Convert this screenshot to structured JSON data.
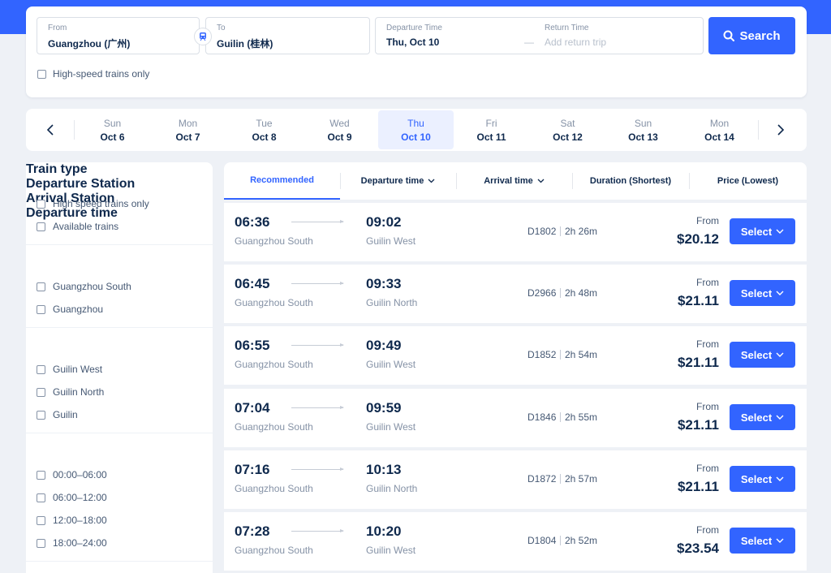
{
  "search": {
    "from_label": "From",
    "from_value": "Guangzhou (广州)",
    "to_label": "To",
    "to_value": "Guilin (桂林)",
    "departure_label": "Departure Time",
    "departure_value": "Thu, Oct 10",
    "return_label": "Return Time",
    "return_dash": "—",
    "return_placeholder": "Add return trip",
    "search_button": "Search",
    "high_speed_label": "High-speed trains only"
  },
  "dates": [
    {
      "day": "Sun",
      "date": "Oct 6"
    },
    {
      "day": "Mon",
      "date": "Oct 7"
    },
    {
      "day": "Tue",
      "date": "Oct 8"
    },
    {
      "day": "Wed",
      "date": "Oct 9"
    },
    {
      "day": "Thu",
      "date": "Oct 10"
    },
    {
      "day": "Fri",
      "date": "Oct 11"
    },
    {
      "day": "Sat",
      "date": "Oct 12"
    },
    {
      "day": "Sun",
      "date": "Oct 13"
    },
    {
      "day": "Mon",
      "date": "Oct 14"
    }
  ],
  "filters": {
    "train_type": {
      "title": "Train type",
      "options": [
        "High speed trains only",
        "Available trains"
      ]
    },
    "departure_station": {
      "title": "Departure Station",
      "options": [
        "Guangzhou South",
        "Guangzhou"
      ]
    },
    "arrival_station": {
      "title": "Arrival Station",
      "options": [
        "Guilin West",
        "Guilin North",
        "Guilin"
      ]
    },
    "departure_time": {
      "title": "Departure time",
      "options": [
        "00:00–06:00",
        "06:00–12:00",
        "12:00–18:00",
        "18:00–24:00"
      ]
    }
  },
  "sort": {
    "tabs": [
      "Recommended",
      "Departure time",
      "Arrival time",
      "Duration (Shortest)",
      "Price (Lowest)"
    ]
  },
  "results": [
    {
      "dep_time": "06:36",
      "dep_station": "Guangzhou South",
      "arr_time": "09:02",
      "arr_station": "Guilin West",
      "train": "D1802",
      "duration": "2h 26m",
      "from_label": "From",
      "price": "$20.12",
      "select": "Select"
    },
    {
      "dep_time": "06:45",
      "dep_station": "Guangzhou South",
      "arr_time": "09:33",
      "arr_station": "Guilin North",
      "train": "D2966",
      "duration": "2h 48m",
      "from_label": "From",
      "price": "$21.11",
      "select": "Select"
    },
    {
      "dep_time": "06:55",
      "dep_station": "Guangzhou South",
      "arr_time": "09:49",
      "arr_station": "Guilin West",
      "train": "D1852",
      "duration": "2h 54m",
      "from_label": "From",
      "price": "$21.11",
      "select": "Select"
    },
    {
      "dep_time": "07:04",
      "dep_station": "Guangzhou South",
      "arr_time": "09:59",
      "arr_station": "Guilin West",
      "train": "D1846",
      "duration": "2h 55m",
      "from_label": "From",
      "price": "$21.11",
      "select": "Select"
    },
    {
      "dep_time": "07:16",
      "dep_station": "Guangzhou South",
      "arr_time": "10:13",
      "arr_station": "Guilin North",
      "train": "D1872",
      "duration": "2h 57m",
      "from_label": "From",
      "price": "$21.11",
      "select": "Select"
    },
    {
      "dep_time": "07:28",
      "dep_station": "Guangzhou South",
      "arr_time": "10:20",
      "arr_station": "Guilin West",
      "train": "D1804",
      "duration": "2h 52m",
      "from_label": "From",
      "price": "$23.54",
      "select": "Select"
    }
  ],
  "colors": {
    "accent": "#3264ff",
    "text": "#0f294d",
    "muted": "#8592a6",
    "background": "#eef1f6"
  },
  "icons": [
    "swap-train-icon",
    "search-icon",
    "chevron-left-icon",
    "chevron-right-icon",
    "chevron-down-icon"
  ]
}
